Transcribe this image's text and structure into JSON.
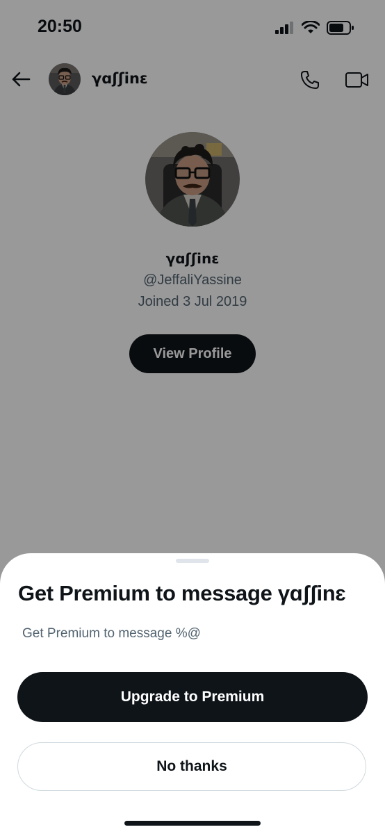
{
  "status_bar": {
    "time": "20:50",
    "signal_icon": "signal-bars-icon",
    "wifi_icon": "wifi-icon",
    "battery_icon": "battery-icon"
  },
  "header": {
    "back_icon": "arrow-left-icon",
    "display_name": "γɑʃʃinɛ",
    "call_icon": "phone-icon",
    "video_icon": "video-camera-icon"
  },
  "profile": {
    "display_name": "γɑʃʃinɛ",
    "handle": "@JeffaliYassine",
    "joined": "Joined 3 Jul 2019",
    "view_profile_label": "View Profile"
  },
  "sheet": {
    "title": "Get Premium to message γɑʃʃinɛ",
    "description": "Get Premium to message %@",
    "upgrade_label": "Upgrade to Premium",
    "no_thanks_label": "No thanks"
  },
  "colors": {
    "primary_text": "#0f1419",
    "secondary_text": "#536471",
    "button_dark": "#0f1419",
    "overlay": "rgba(0,0,0,0.40)"
  }
}
